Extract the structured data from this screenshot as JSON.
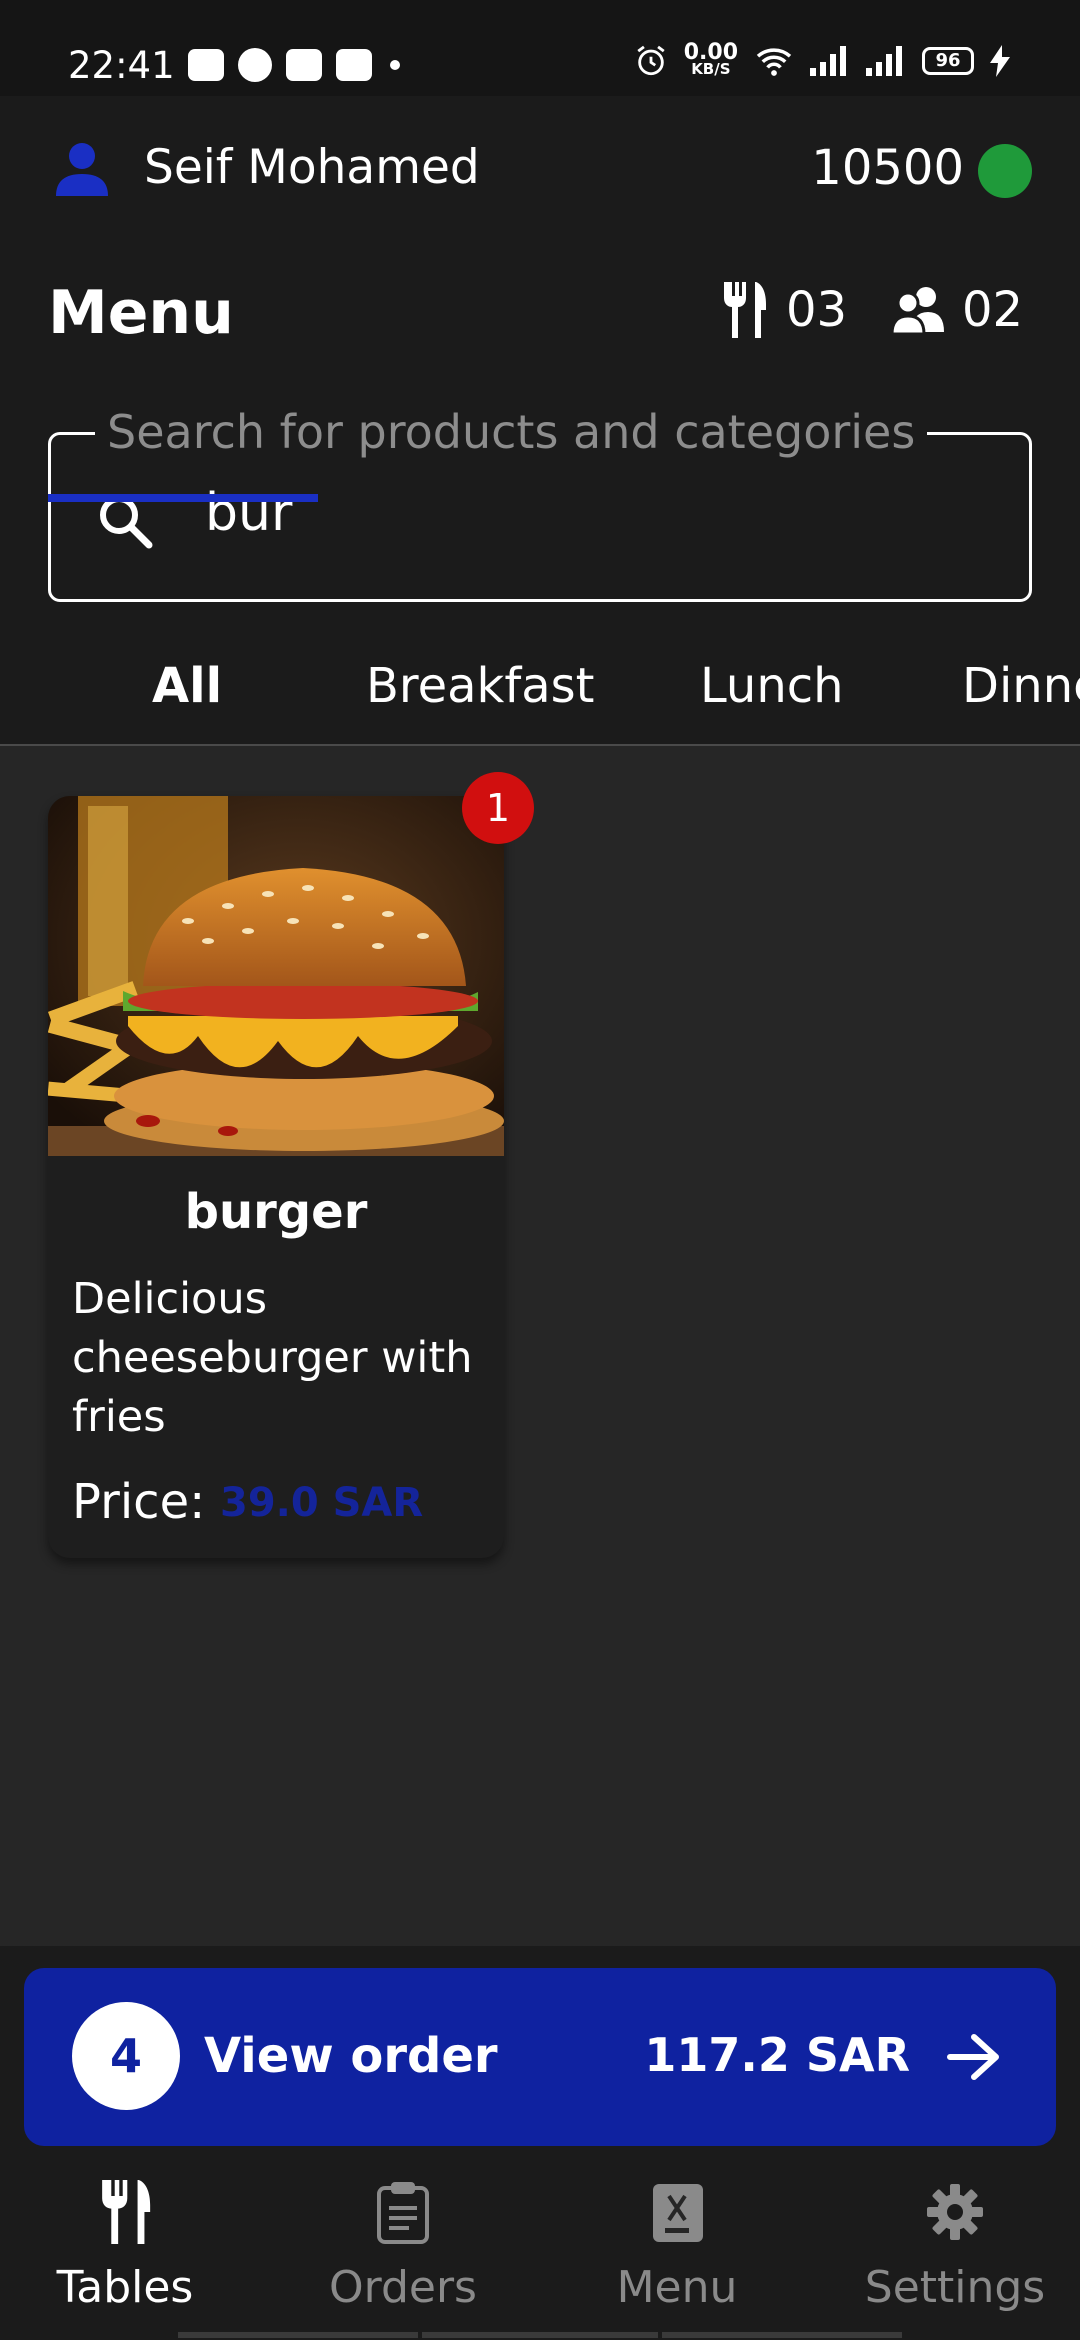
{
  "status_bar": {
    "time": "22:41",
    "net_speed_value": "0.00",
    "net_speed_unit": "KB/S",
    "battery": "96"
  },
  "header": {
    "user_name": "Seif Mohamed",
    "balance": "10500",
    "online_color": "#1f9a3a"
  },
  "page": {
    "title": "Menu",
    "tables_count": "03",
    "guests_count": "02"
  },
  "search": {
    "placeholder": "Search for products and categories",
    "value": "bur"
  },
  "tabs": [
    {
      "label": "All",
      "active": true
    },
    {
      "label": "Breakfast",
      "active": false
    },
    {
      "label": "Lunch",
      "active": false
    },
    {
      "label": "Dinner",
      "active": false
    }
  ],
  "products": [
    {
      "name": "burger",
      "description": "Delicious cheeseburger with fries",
      "price_label": "Price:",
      "price": "39.0 SAR",
      "quantity_badge": "1"
    }
  ],
  "order_bar": {
    "item_count": "4",
    "label": "View order",
    "total": "117.2 SAR"
  },
  "bottom_nav": [
    {
      "label": "Tables",
      "icon": "fork-knife-icon",
      "active": true
    },
    {
      "label": "Orders",
      "icon": "clipboard-icon",
      "active": false
    },
    {
      "label": "Menu",
      "icon": "menu-book-icon",
      "active": false
    },
    {
      "label": "Settings",
      "icon": "gear-icon",
      "active": false
    }
  ],
  "colors": {
    "accent": "#0f22a0",
    "price": "#14249a",
    "badge": "#d10f0f",
    "background": "#262626"
  }
}
